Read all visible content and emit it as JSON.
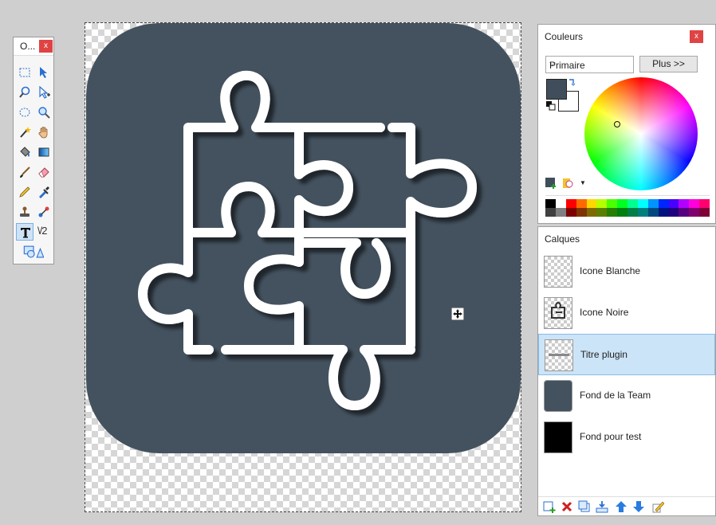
{
  "tools_window": {
    "title": "O...",
    "close": "x"
  },
  "tools": [
    "rectangle-select-icon",
    "move-selection-icon",
    "zoom-icon",
    "move-selected-icon",
    "ellipse-select-icon",
    "magnifier-icon",
    "magic-wand-icon",
    "pan-hand-icon",
    "paint-bucket-icon",
    "gradient-icon",
    "paintbrush-icon",
    "eraser-icon",
    "pencil-icon",
    "color-picker-icon",
    "clone-stamp-icon",
    "recolor-icon",
    "text-icon",
    "line-curve-icon",
    "shapes-icon"
  ],
  "line_curve_label": "\\/2",
  "colors_panel": {
    "title": "Couleurs",
    "close": "x",
    "mode": "Primaire",
    "more_button": "Plus >>",
    "primary_color": "#3f4e5a",
    "secondary_color": "#ffffff",
    "palette_top": [
      "#000000",
      "#ffffff",
      "#ff0000",
      "#ff6a00",
      "#ffd800",
      "#b6ff00",
      "#4cff00",
      "#00ff21",
      "#00ff90",
      "#00ffff",
      "#0094ff",
      "#0026ff",
      "#4800ff",
      "#b200ff",
      "#ff00dc",
      "#ff006e"
    ],
    "palette_bottom": [
      "#404040",
      "#808080",
      "#7f0000",
      "#7f3300",
      "#7f6a00",
      "#5b7f00",
      "#267f00",
      "#007f0e",
      "#007f46",
      "#007f7f",
      "#004a7f",
      "#00137f",
      "#21007f",
      "#57007f",
      "#7f006e",
      "#7f0037"
    ]
  },
  "layers_panel": {
    "title": "Calques",
    "layers": [
      {
        "name": "Icone Blanche",
        "selected": false
      },
      {
        "name": "Icone Noire",
        "selected": false
      },
      {
        "name": "Titre plugin",
        "selected": true
      },
      {
        "name": "Fond de la Team",
        "selected": false
      },
      {
        "name": "Fond pour test",
        "selected": false
      }
    ],
    "toolbar": [
      "add-layer-icon",
      "delete-layer-icon",
      "duplicate-layer-icon",
      "merge-layer-down-icon",
      "move-layer-up-icon",
      "move-layer-down-icon",
      "layer-properties-icon"
    ]
  },
  "canvas": {
    "background_color": "#44525f",
    "icon_color": "#ffffff"
  }
}
